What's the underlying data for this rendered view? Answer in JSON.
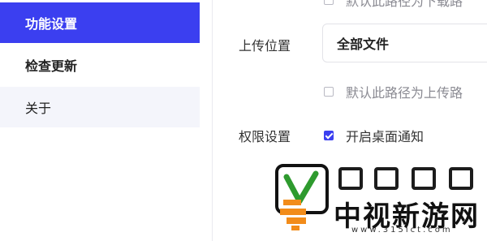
{
  "sidebar": {
    "items": [
      {
        "label": "功能设置",
        "active": true
      },
      {
        "label": "检查更新",
        "active": false
      },
      {
        "label": "关于",
        "active": false
      }
    ],
    "accent_color": "#3b3ff0"
  },
  "settings": {
    "top_partial_option": "默认此路径为下载路",
    "upload_location": {
      "label": "上传位置",
      "selected": "全部文件",
      "default_path_option": "默认此路径为上传路"
    },
    "permissions": {
      "label": "权限设置",
      "desktop_notification": "开启桌面通知",
      "desktop_notification_checked": true
    }
  },
  "watermark": {
    "site_name": "中视新游网",
    "url": "www.315ict.com"
  }
}
